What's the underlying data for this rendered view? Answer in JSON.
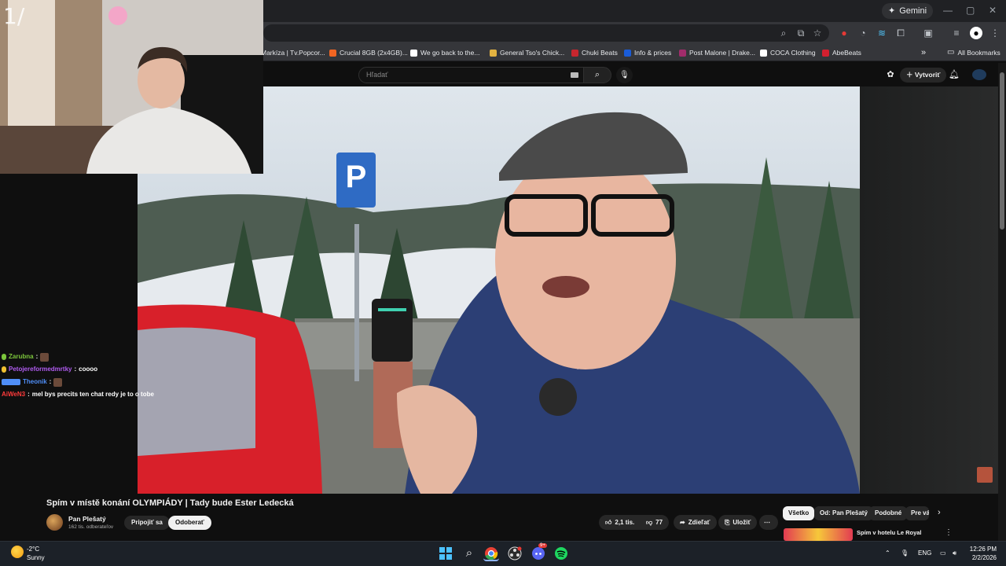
{
  "browser": {
    "gemini_label": "Gemini",
    "all_bookmarks": "All Bookmarks",
    "bookmarks": [
      {
        "label": "Markíza | Tv.Popcor...",
        "color": "#5b2b8a"
      },
      {
        "label": "Crucial 8GB (2x4GB)...",
        "color": "#f26522"
      },
      {
        "label": "We go back to the...",
        "color": "#ffffff"
      },
      {
        "label": "General Tso's Chick...",
        "color": "#e3b341"
      },
      {
        "label": "Chuki Beats",
        "color": "#c6262e"
      },
      {
        "label": "Info & prices",
        "color": "#1a5cd8"
      },
      {
        "label": "Post Malone | Drake...",
        "color": "#a12c6b"
      },
      {
        "label": "COCA Clothing",
        "color": "#ffffff"
      },
      {
        "label": "AbeBeats",
        "color": "#d3202f"
      }
    ]
  },
  "youtube": {
    "search_placeholder": "Hľadať",
    "create_label": "Vytvoriť",
    "video_title": "Spím v místě konání OLYMPIÁDY | Tady bude Ester Ledecká",
    "channel_name": "Pan Plešatý",
    "channel_subs": "162 tis. odberateľov",
    "join_label": "Pripojiť sa",
    "unsubscribe_label": "Odoberať",
    "likes": "2,1 tis.",
    "dislikes": "77",
    "share_label": "Zdieľať",
    "save_label": "Uložiť",
    "chips": [
      "Všetko",
      "Od: Pan Plešatý",
      "Podobné",
      "Pre vás"
    ],
    "rec_title": "Spím v hotelu Le Royal"
  },
  "chat": [
    {
      "user": "Zarubna",
      "color": "#7cc63c",
      "msg": "",
      "emote": true
    },
    {
      "user": "Petojereformedmrtky",
      "color": "#b05cf0",
      "msg": "coooo",
      "emote": false
    },
    {
      "user": "Theonik",
      "color": "#4f8ef7",
      "msg": "",
      "emote": true
    },
    {
      "user": "AiWeN3",
      "color": "#ff3b3b",
      "msg": "mel bys precits ten chat redy je to o tobe",
      "emote": false
    }
  ],
  "webcam": {
    "counter": "1/"
  },
  "taskbar": {
    "temperature": "-2°C",
    "condition": "Sunny",
    "language": "ENG",
    "time": "12:26 PM",
    "date": "2/2/2026",
    "discord_badge": "9+"
  }
}
